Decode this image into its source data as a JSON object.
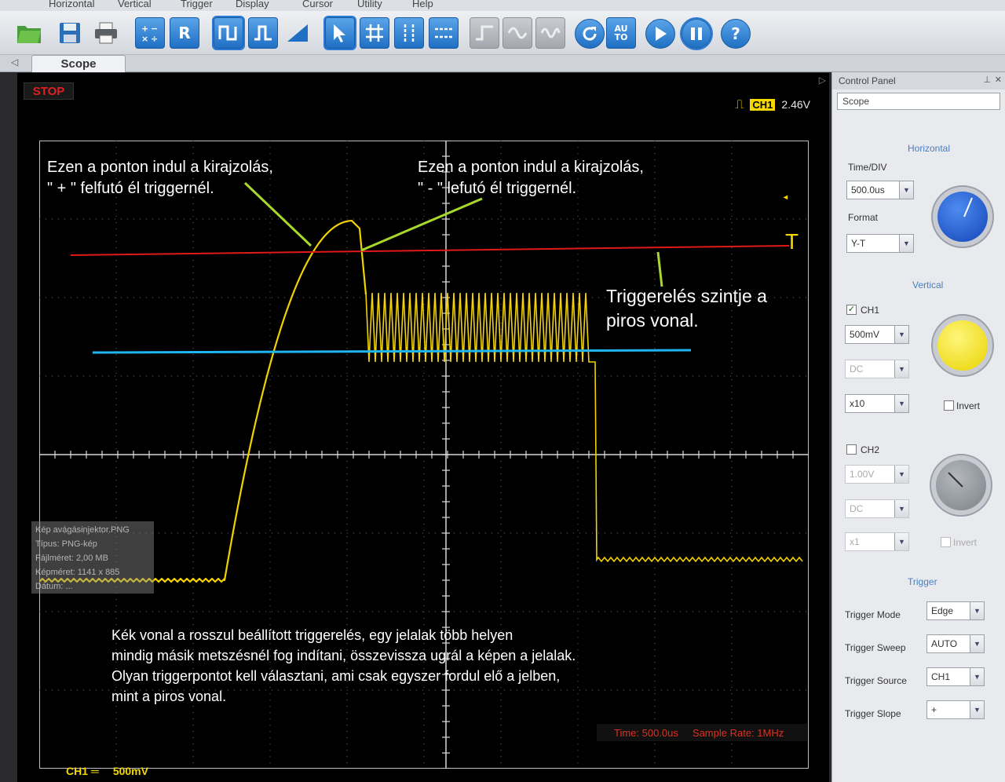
{
  "menu": [
    "Horizontal",
    "Vertical",
    "Trigger",
    "Display",
    "Cursor",
    "Utility",
    "Help"
  ],
  "toolbar": {
    "ratio_label": "R",
    "auto_label": "AU\nTO",
    "help_label": "?"
  },
  "tab": {
    "label": "Scope"
  },
  "scope": {
    "status": "STOP",
    "trigger_channel": "CH1",
    "trigger_level": "2.46V",
    "trigger_marker": "T",
    "time_status": "Time: 500.0us",
    "sample_rate": "Sample Rate: 1MHz",
    "ch1_footer_label": "CH1 ═",
    "ch1_footer_value": "500mV"
  },
  "ghost_tooltip": {
    "lines": [
      "Kép avágásinjektor.PNG",
      "Típus: PNG-kép",
      "Fájlméret: 2,00 MB",
      "Képméret: 1141 x 885",
      "Dátum: ..."
    ]
  },
  "annotations": {
    "rising_line1": "Ezen a ponton indul a kirajzolás,",
    "rising_line2": " \" + \" felfutó él triggernél.",
    "falling_line1": "Ezen a ponton indul a kirajzolás,",
    "falling_line2": " \" - \" lefutó él triggernél.",
    "trigger_level_line1": "Triggerelés szintje a",
    "trigger_level_line2": "piros vonal.",
    "bottom_lines": [
      "Kék vonal a rosszul beállított triggerelés, egy jelalak több helyen",
      "mindig másik metszésnél fog indítani, összevissza ugrál a képen a jelalak.",
      "Olyan triggerpontot kell választani, ami csak egyszer fordul elő a jelben,",
      "mint a piros vonal."
    ],
    "trigger_arrow_label": "T"
  },
  "colors": {
    "waveform": "#f2d200",
    "trigger_good": "#e01818",
    "trigger_bad": "#1fb5f0",
    "pointer": "#a8d82a"
  },
  "panel": {
    "title": "Control Panel",
    "selector": "Scope",
    "horizontal": {
      "title": "Horizontal",
      "timediv_label": "Time/DIV",
      "timediv_value": "500.0us",
      "format_label": "Format",
      "format_value": "Y-T"
    },
    "vertical": {
      "title": "Vertical",
      "ch1_label": "CH1",
      "ch1_volts": "500mV",
      "ch1_coupling": "DC",
      "ch1_probe": "x10",
      "invert_label": "Invert",
      "ch2_label": "CH2",
      "ch2_volts": "1.00V",
      "ch2_coupling": "DC",
      "ch2_probe": "x1",
      "ch2_invert_label": "Invert"
    },
    "trigger": {
      "title": "Trigger",
      "mode_label": "Trigger Mode",
      "mode_value": "Edge",
      "sweep_label": "Trigger Sweep",
      "sweep_value": "AUTO",
      "source_label": "Trigger Source",
      "source_value": "CH1",
      "slope_label": "Trigger Slope",
      "slope_value": "+"
    }
  }
}
